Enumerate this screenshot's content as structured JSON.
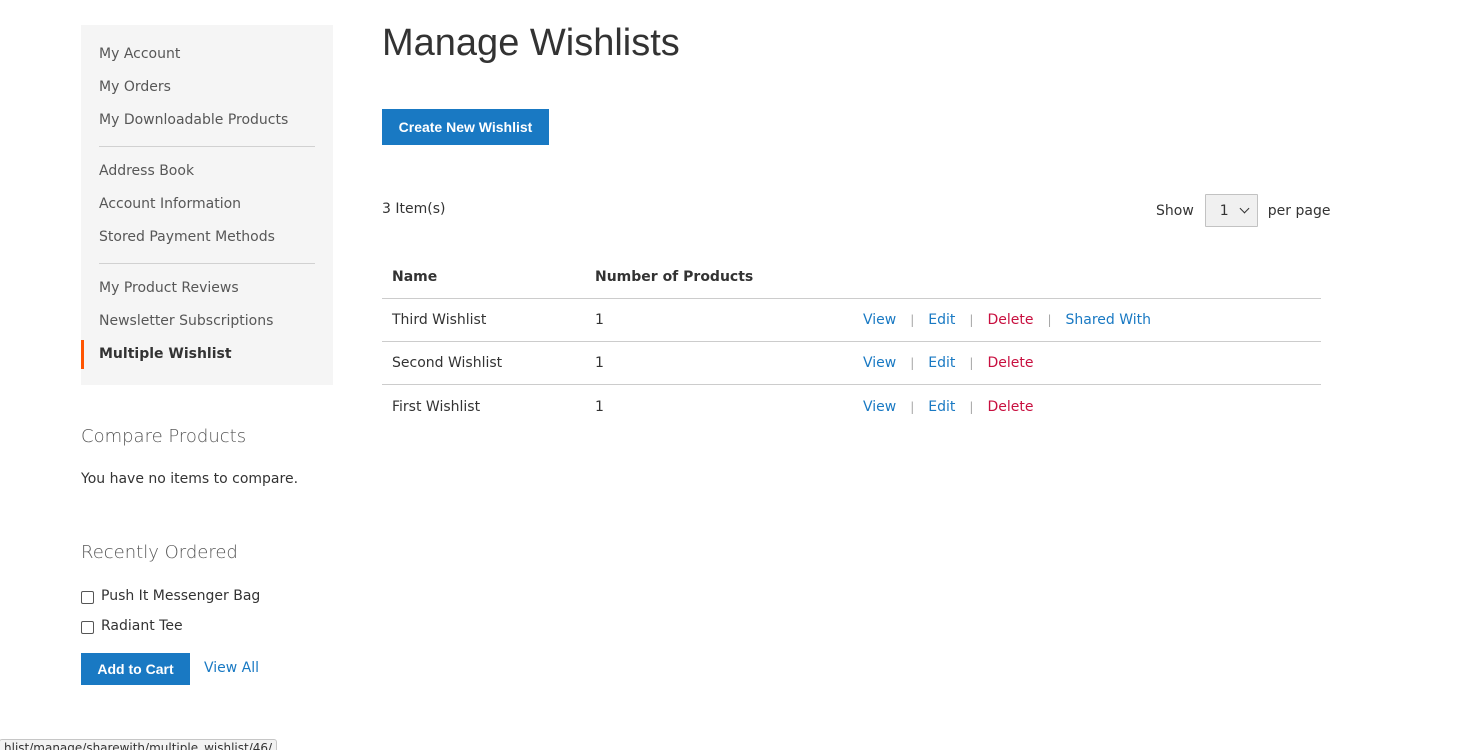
{
  "sidebar": {
    "groups": [
      [
        {
          "label": "My Account"
        },
        {
          "label": "My Orders"
        },
        {
          "label": "My Downloadable Products"
        }
      ],
      [
        {
          "label": "Address Book"
        },
        {
          "label": "Account Information"
        },
        {
          "label": "Stored Payment Methods"
        }
      ],
      [
        {
          "label": "My Product Reviews"
        },
        {
          "label": "Newsletter Subscriptions"
        },
        {
          "label": "Multiple Wishlist",
          "current": true
        }
      ]
    ],
    "accent_color": "#ff5501"
  },
  "compare": {
    "title": "Compare Products",
    "empty_text": "You have no items to compare."
  },
  "recently_ordered": {
    "title": "Recently Ordered",
    "items": [
      "Push It Messenger Bag",
      "Radiant Tee"
    ],
    "add_to_cart_label": "Add to Cart",
    "view_all_label": "View All"
  },
  "main": {
    "title": "Manage Wishlists",
    "create_button_label": "Create New Wishlist",
    "item_count": "3 Item(s)",
    "limiter": {
      "show_label": "Show",
      "selected": "1",
      "per_page_label": "per page"
    },
    "table": {
      "headers": [
        "Name",
        "Number of Products"
      ],
      "rows": [
        {
          "name": "Third Wishlist",
          "count": "1",
          "actions": [
            "View",
            "Edit",
            "Delete",
            "Shared With"
          ]
        },
        {
          "name": "Second Wishlist",
          "count": "1",
          "actions": [
            "View",
            "Edit",
            "Delete"
          ]
        },
        {
          "name": "First Wishlist",
          "count": "1",
          "actions": [
            "View",
            "Edit",
            "Delete"
          ]
        }
      ]
    }
  },
  "status_bar": {
    "url": "hlist/manage/sharewith/multiple_wishlist/46/"
  },
  "colors": {
    "primary": "#1979c3",
    "danger": "#c80f3f"
  }
}
